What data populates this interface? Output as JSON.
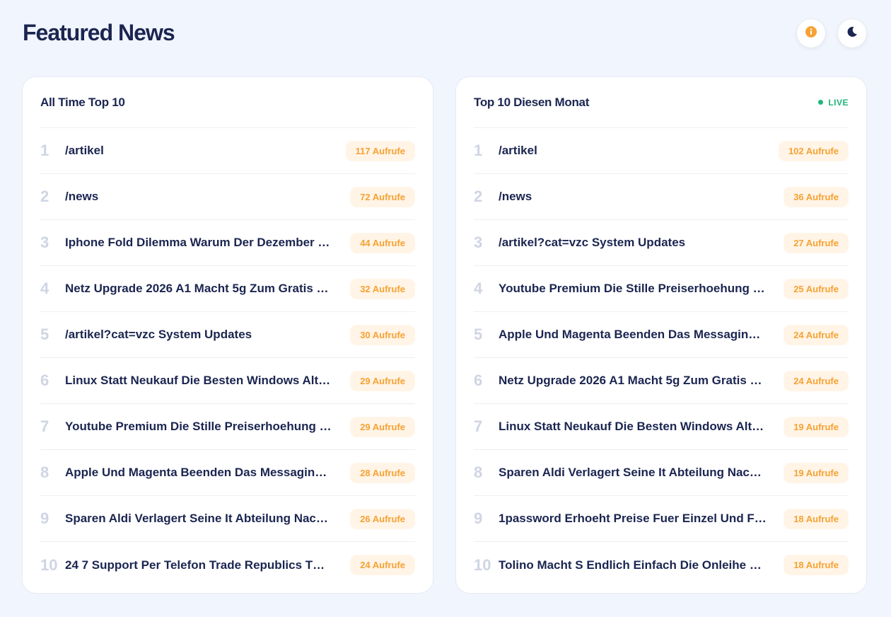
{
  "header": {
    "title": "Featured News",
    "info_icon": "info-icon",
    "theme_icon": "moon-icon"
  },
  "colors": {
    "background": "#f1f5fd",
    "text": "#1b2550",
    "accent": "#f6a233",
    "badge_bg": "#fff4e6",
    "live": "#1fb67a",
    "rank": "#cfd5e3"
  },
  "panels": [
    {
      "title": "All Time Top 10",
      "live": "",
      "items": [
        {
          "rank": "1",
          "title": "/artikel",
          "views": "117 Aufrufe"
        },
        {
          "rank": "2",
          "title": "/news",
          "views": "72 Aufrufe"
        },
        {
          "rank": "3",
          "title": "Iphone Fold Dilemma Warum Der Dezember …",
          "views": "44 Aufrufe"
        },
        {
          "rank": "4",
          "title": "Netz Upgrade 2026 A1 Macht 5g Zum Gratis …",
          "views": "32 Aufrufe"
        },
        {
          "rank": "5",
          "title": "/artikel?cat=vzc System Updates",
          "views": "30 Aufrufe"
        },
        {
          "rank": "6",
          "title": "Linux Statt Neukauf Die Besten Windows Alt…",
          "views": "29 Aufrufe"
        },
        {
          "rank": "7",
          "title": "Youtube Premium Die Stille Preiserhoehung …",
          "views": "29 Aufrufe"
        },
        {
          "rank": "8",
          "title": "Apple Und Magenta Beenden Das Messagin…",
          "views": "28 Aufrufe"
        },
        {
          "rank": "9",
          "title": "Sparen Aldi Verlagert Seine It Abteilung Nac…",
          "views": "26 Aufrufe"
        },
        {
          "rank": "10",
          "title": "24 7 Support Per Telefon Trade Republics T…",
          "views": "24 Aufrufe"
        }
      ]
    },
    {
      "title": "Top 10 Diesen Monat",
      "live": "LIVE",
      "items": [
        {
          "rank": "1",
          "title": "/artikel",
          "views": "102 Aufrufe"
        },
        {
          "rank": "2",
          "title": "/news",
          "views": "36 Aufrufe"
        },
        {
          "rank": "3",
          "title": "/artikel?cat=vzc System Updates",
          "views": "27 Aufrufe"
        },
        {
          "rank": "4",
          "title": "Youtube Premium Die Stille Preiserhoehung …",
          "views": "25 Aufrufe"
        },
        {
          "rank": "5",
          "title": "Apple Und Magenta Beenden Das Messagin…",
          "views": "24 Aufrufe"
        },
        {
          "rank": "6",
          "title": "Netz Upgrade 2026 A1 Macht 5g Zum Gratis …",
          "views": "24 Aufrufe"
        },
        {
          "rank": "7",
          "title": "Linux Statt Neukauf Die Besten Windows Alt…",
          "views": "19 Aufrufe"
        },
        {
          "rank": "8",
          "title": "Sparen Aldi Verlagert Seine It Abteilung Nac…",
          "views": "19 Aufrufe"
        },
        {
          "rank": "9",
          "title": "1password Erhoeht Preise Fuer Einzel Und F…",
          "views": "18 Aufrufe"
        },
        {
          "rank": "10",
          "title": "Tolino Macht S Endlich Einfach Die Onleihe …",
          "views": "18 Aufrufe"
        }
      ]
    }
  ]
}
